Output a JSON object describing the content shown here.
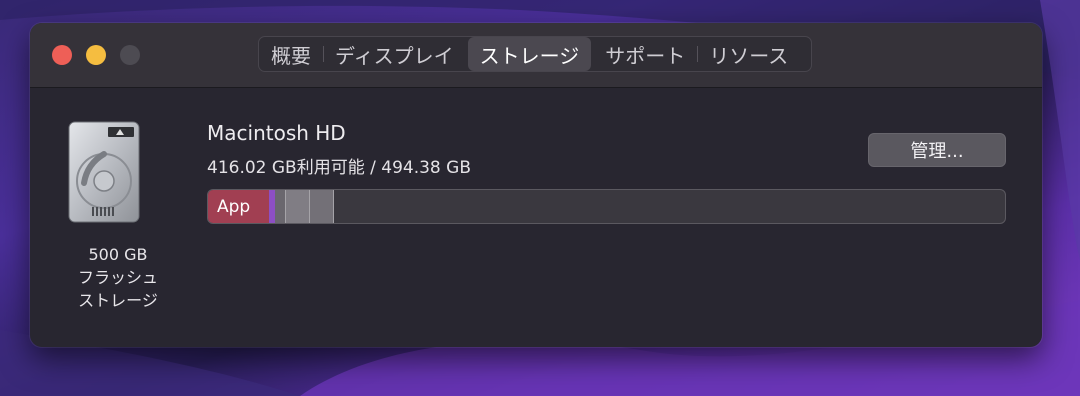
{
  "window": {
    "tabs": [
      {
        "label": "概要"
      },
      {
        "label": "ディスプレイ"
      },
      {
        "label": "ストレージ",
        "active": true
      },
      {
        "label": "サポート"
      },
      {
        "label": "リソース"
      }
    ]
  },
  "disk": {
    "icon": "hard-drive-icon",
    "size_label": "500 GB",
    "type_line1": "フラッシュ",
    "type_line2": "ストレージ"
  },
  "volume": {
    "name": "Macintosh HD",
    "capacity": "416.02 GB利用可能 / 494.38 GB",
    "manage_label": "管理...",
    "storage_bar": {
      "app_label": "App",
      "segments": [
        {
          "category": "App",
          "color": "#a13f52"
        },
        {
          "category": "other-purple",
          "color": "#8d4fc4"
        },
        {
          "category": "other-gray",
          "color": "#6a676e"
        },
        {
          "category": "other-gray",
          "color": "#807d84"
        },
        {
          "category": "other-gray",
          "color": "#737077"
        }
      ],
      "free_color": "#3a383f"
    }
  },
  "colors": {
    "close": "#ee5f57",
    "minimize": "#f5bd40",
    "maximize": "#4d4b52"
  }
}
